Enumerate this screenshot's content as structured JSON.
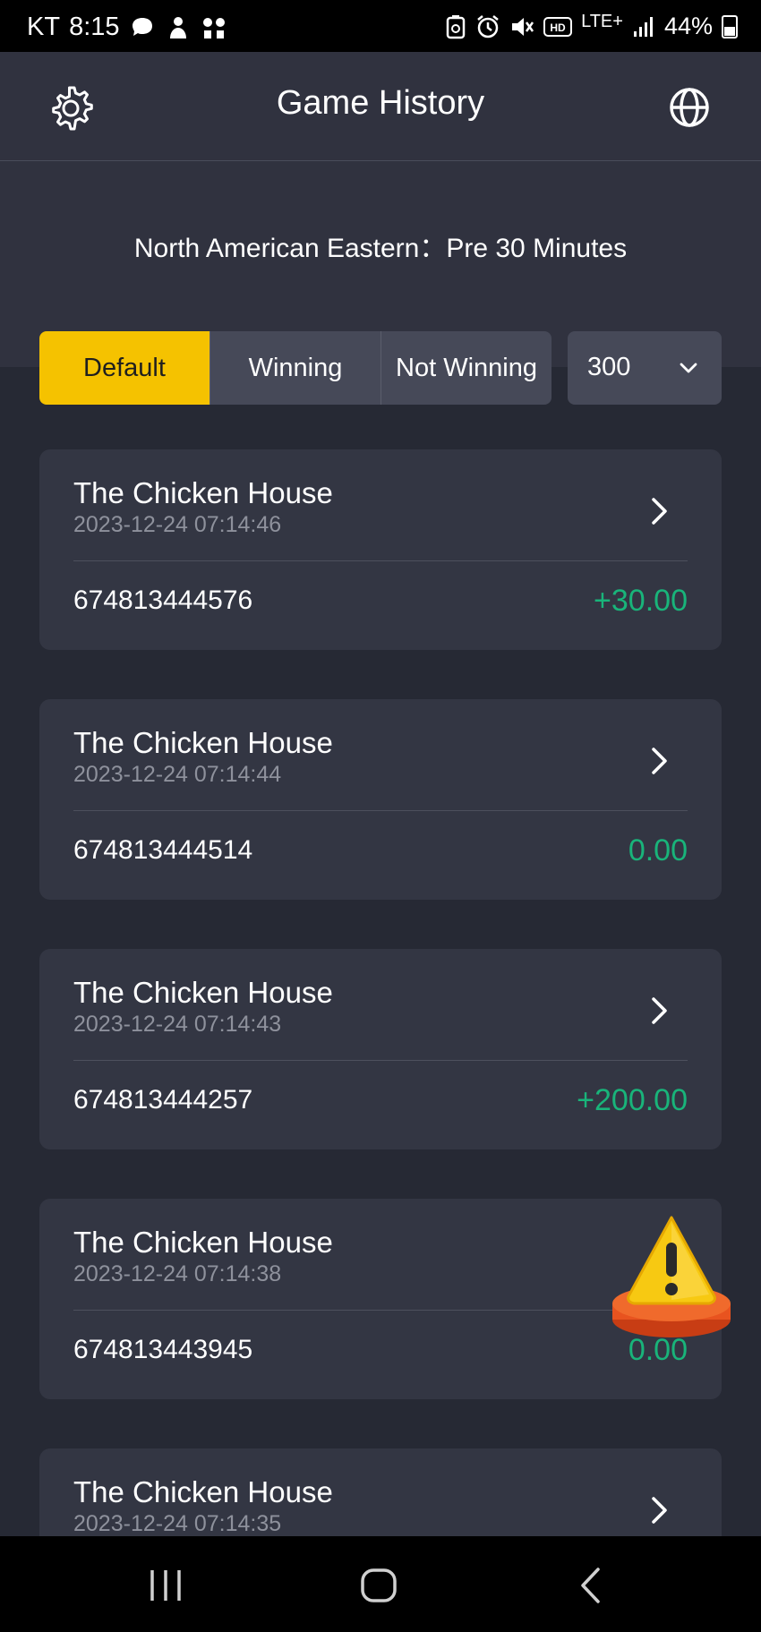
{
  "status_bar": {
    "carrier": "KT",
    "time": "8:15",
    "network": "LTE+",
    "battery": "44%",
    "icons_left": [
      "chat-bubble-icon",
      "person-icon",
      "apps-grid-icon"
    ],
    "icons_right": [
      "battery-saver-icon",
      "alarm-icon",
      "mute-icon",
      "hd-icon",
      "signal-icon",
      "battery-icon"
    ]
  },
  "header": {
    "title": "Game History",
    "left_icon": "gear-icon",
    "right_icon": "globe-icon"
  },
  "timezone": {
    "text": "North American Eastern：Pre 30 Minutes"
  },
  "filters": {
    "tabs": [
      {
        "label": "Default",
        "active": true
      },
      {
        "label": "Winning",
        "active": false
      },
      {
        "label": "Not Winning",
        "active": false
      }
    ],
    "count_select": {
      "value": "300"
    }
  },
  "records": [
    {
      "title": "The Chicken House",
      "date": "2023-12-24 07:14:46",
      "id": "674813444576",
      "amount": "+30.00"
    },
    {
      "title": "The Chicken House",
      "date": "2023-12-24 07:14:44",
      "id": "674813444514",
      "amount": "0.00"
    },
    {
      "title": "The Chicken House",
      "date": "2023-12-24 07:14:43",
      "id": "674813444257",
      "amount": "+200.00"
    },
    {
      "title": "The Chicken House",
      "date": "2023-12-24 07:14:38",
      "id": "674813443945",
      "amount": "0.00"
    },
    {
      "title": "The Chicken House",
      "date": "2023-12-24 07:14:35",
      "id": "",
      "amount": ""
    }
  ],
  "colors": {
    "background": "#262934",
    "panel": "#30323f",
    "card": "#333643",
    "accent": "#f5c200",
    "amount_green": "#19b47a"
  },
  "nav_bar": {
    "icons": [
      "recent-apps-icon",
      "home-icon",
      "back-icon"
    ]
  }
}
